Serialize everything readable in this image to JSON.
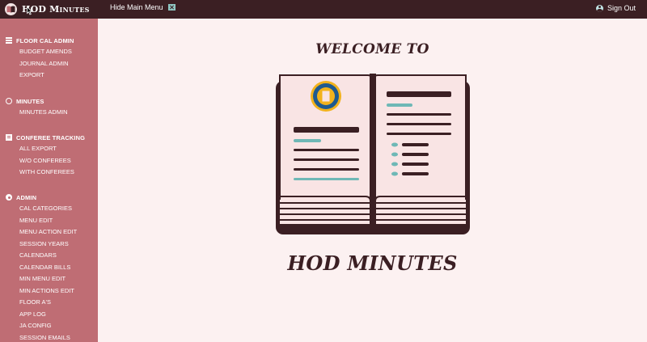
{
  "app": {
    "title": "HOD Minutes",
    "title_main": "HOD M",
    "title_small": "INUTES"
  },
  "topbar": {
    "hide_menu_label": "Hide Main Menu",
    "signout_label": "Sign Out"
  },
  "sidebar": {
    "sections": [
      {
        "icon": "menu-icon",
        "label": "FLOOR CAL ADMIN",
        "items": [
          "BUDGET AMENDS",
          "JOURNAL ADMIN",
          "EXPORT"
        ]
      },
      {
        "icon": "circle-icon",
        "label": "MINUTES",
        "items": [
          "MINUTES ADMIN"
        ]
      },
      {
        "icon": "document-icon",
        "label": "CONFEREE TRACKING",
        "items": [
          "ALL EXPORT",
          "W/O CONFEREES",
          "WITH CONFEREES"
        ]
      },
      {
        "icon": "gear-icon",
        "label": "ADMIN",
        "items": [
          "CAL CATEGORIES",
          "MENU EDIT",
          "MENU ACTION EDIT",
          "SESSION YEARS",
          "CALENDARS",
          "CALENDAR BILLS",
          "MIN MENU EDIT",
          "MIN ACTIONS EDIT",
          "FLOOR A'S",
          "APP LOG",
          "JA CONFIG",
          "SESSION EMAILS"
        ]
      }
    ]
  },
  "main": {
    "welcome_text": "WELCOME TO",
    "app_name": "HOD MINUTES"
  },
  "colors": {
    "topbar": "#3b1f23",
    "sidebar": "#bf6d74",
    "background": "#fcf1f1",
    "accent_teal": "#6fb8b6",
    "badge_blue": "#1f5a8f",
    "badge_gold": "#f2b21c"
  }
}
